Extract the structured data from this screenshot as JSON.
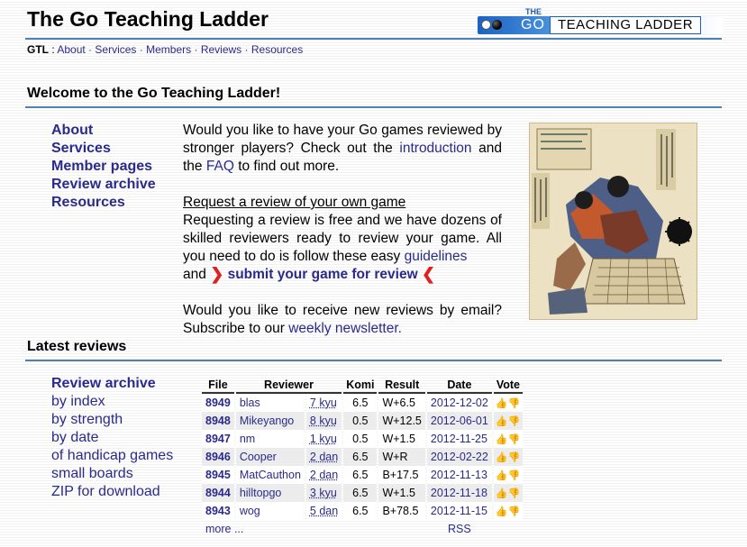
{
  "header": {
    "site_title": "The Go Teaching Ladder",
    "logo": {
      "small": "THE",
      "go": "GO",
      "ladder": "TEACHING LADDER"
    }
  },
  "nav": {
    "home": "GTL",
    "colon": ":",
    "links": [
      "About",
      "Services",
      "Members",
      "Reviews",
      "Resources"
    ],
    "separator": "·"
  },
  "welcome": {
    "title": "Welcome to the Go Teaching Ladder!",
    "menu": [
      "About",
      "Services",
      "Member pages",
      "Review archive",
      "Resources"
    ],
    "para1": {
      "t1": "Would you like to have your Go games reviewed by stronger players? Check out the",
      "link_intro": "introduction",
      "t2": "and the",
      "link_faq": "FAQ",
      "t3": "to find out more."
    },
    "request": {
      "heading": "Request a review of your own game",
      "t1": "Requesting a review is free and we have dozens of skilled reviewers ready to review your game. All you need to do is follow these easy",
      "link_guidelines": "guidelines",
      "t2": "and",
      "submit": "submit your game for review",
      "arrow_left": "❯",
      "arrow_right": "❮"
    },
    "email": {
      "t1": "Would you like to receive new reviews by email? Subscribe to our",
      "link_newsletter": "weekly newsletter."
    }
  },
  "latest": {
    "title": "Latest reviews",
    "menu_head": "Review archive",
    "menu": [
      "by index",
      "by strength",
      "by date",
      "of handicap games",
      "small boards",
      "ZIP for download"
    ]
  },
  "table": {
    "headers": [
      "File",
      "Reviewer",
      "",
      "Komi",
      "Result",
      "Date",
      "Vote"
    ],
    "rows": [
      {
        "file": "8949",
        "reviewer": "blas",
        "rank": "7 kyu",
        "komi": "6.5",
        "result": "W+6.5",
        "date": "2012-12-02"
      },
      {
        "file": "8948",
        "reviewer": "Mikeyango",
        "rank": "8 kyu",
        "komi": "0.5",
        "result": "W+12.5",
        "date": "2012-06-01"
      },
      {
        "file": "8947",
        "reviewer": "nm",
        "rank": "1 kyu",
        "komi": "0.5",
        "result": "W+1.5",
        "date": "2012-11-25"
      },
      {
        "file": "8946",
        "reviewer": "Cooper",
        "rank": "2 dan",
        "komi": "6.5",
        "result": "W+R",
        "date": "2012-02-22"
      },
      {
        "file": "8945",
        "reviewer": "MatCauthon",
        "rank": "2 dan",
        "komi": "6.5",
        "result": "B+17.5",
        "date": "2012-11-13"
      },
      {
        "file": "8944",
        "reviewer": "hilltopgo",
        "rank": "3 kyu",
        "komi": "6.5",
        "result": "W+1.5",
        "date": "2012-11-18"
      },
      {
        "file": "8943",
        "reviewer": "wog",
        "rank": "5 dan",
        "komi": "6.5",
        "result": "B+78.5",
        "date": "2012-11-15"
      }
    ],
    "vote_up": "👍",
    "vote_down": "👎",
    "more": "more ...",
    "rss": "RSS"
  }
}
